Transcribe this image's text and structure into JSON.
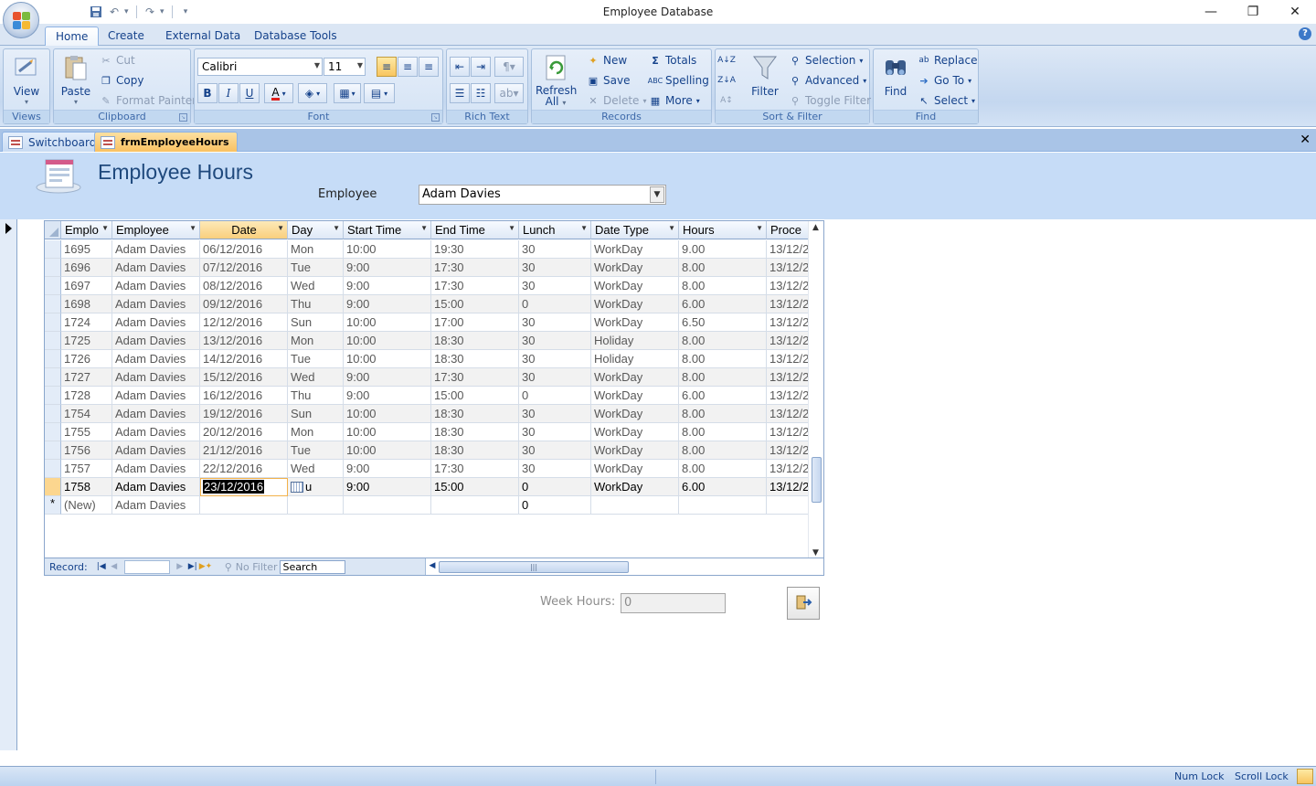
{
  "window": {
    "title": "Employee Database",
    "minimize_glyph": "—",
    "restore_glyph": "❐",
    "close_glyph": "✕"
  },
  "ribbon_tabs": [
    "Home",
    "Create",
    "External Data",
    "Database Tools"
  ],
  "ribbon": {
    "views": {
      "view_label": "View",
      "group_label": "Views"
    },
    "clipboard": {
      "paste_label": "Paste",
      "cut_label": "Cut",
      "copy_label": "Copy",
      "format_painter_label": "Format Painter",
      "group_label": "Clipboard"
    },
    "font": {
      "font_name": "Calibri",
      "font_size": "11",
      "bold": "B",
      "italic": "I",
      "underline": "U",
      "group_label": "Font"
    },
    "rich_text": {
      "group_label": "Rich Text"
    },
    "records": {
      "refresh_label": "Refresh",
      "refresh_label2": "All",
      "new_label": "New",
      "save_label": "Save",
      "delete_label": "Delete",
      "totals_label": "Totals",
      "spelling_label": "Spelling",
      "more_label": "More",
      "group_label": "Records"
    },
    "sort_filter": {
      "filter_label": "Filter",
      "selection_label": "Selection",
      "advanced_label": "Advanced",
      "toggle_filter_label": "Toggle Filter",
      "group_label": "Sort & Filter"
    },
    "find": {
      "find_label": "Find",
      "replace_label": "Replace",
      "goto_label": "Go To",
      "select_label": "Select",
      "group_label": "Find"
    }
  },
  "doc_tabs": [
    {
      "label": "Switchboard",
      "active": false
    },
    {
      "label": "frmEmployeeHours",
      "active": true
    }
  ],
  "form": {
    "title": "Employee Hours",
    "employee_label": "Employee",
    "employee_value": "Adam Davies"
  },
  "datasheet": {
    "columns": [
      "Emplo",
      "Employee",
      "Date",
      "Day",
      "Start Time",
      "End Time",
      "Lunch",
      "Date Type",
      "Hours",
      "Proce"
    ],
    "rows": [
      [
        "1695",
        "Adam Davies",
        "06/12/2016",
        "Mon",
        "10:00",
        "19:30",
        "30",
        "WorkDay",
        "9.00",
        "13/12/2"
      ],
      [
        "1696",
        "Adam Davies",
        "07/12/2016",
        "Tue",
        "9:00",
        "17:30",
        "30",
        "WorkDay",
        "8.00",
        "13/12/2"
      ],
      [
        "1697",
        "Adam Davies",
        "08/12/2016",
        "Wed",
        "9:00",
        "17:30",
        "30",
        "WorkDay",
        "8.00",
        "13/12/2"
      ],
      [
        "1698",
        "Adam Davies",
        "09/12/2016",
        "Thu",
        "9:00",
        "15:00",
        "0",
        "WorkDay",
        "6.00",
        "13/12/2"
      ],
      [
        "1724",
        "Adam Davies",
        "12/12/2016",
        "Sun",
        "10:00",
        "17:00",
        "30",
        "WorkDay",
        "6.50",
        "13/12/2"
      ],
      [
        "1725",
        "Adam Davies",
        "13/12/2016",
        "Mon",
        "10:00",
        "18:30",
        "30",
        "Holiday",
        "8.00",
        "13/12/2"
      ],
      [
        "1726",
        "Adam Davies",
        "14/12/2016",
        "Tue",
        "10:00",
        "18:30",
        "30",
        "Holiday",
        "8.00",
        "13/12/2"
      ],
      [
        "1727",
        "Adam Davies",
        "15/12/2016",
        "Wed",
        "9:00",
        "17:30",
        "30",
        "WorkDay",
        "8.00",
        "13/12/2"
      ],
      [
        "1728",
        "Adam Davies",
        "16/12/2016",
        "Thu",
        "9:00",
        "15:00",
        "0",
        "WorkDay",
        "6.00",
        "13/12/2"
      ],
      [
        "1754",
        "Adam Davies",
        "19/12/2016",
        "Sun",
        "10:00",
        "18:30",
        "30",
        "WorkDay",
        "8.00",
        "13/12/2"
      ],
      [
        "1755",
        "Adam Davies",
        "20/12/2016",
        "Mon",
        "10:00",
        "18:30",
        "30",
        "WorkDay",
        "8.00",
        "13/12/2"
      ],
      [
        "1756",
        "Adam Davies",
        "21/12/2016",
        "Tue",
        "10:00",
        "18:30",
        "30",
        "WorkDay",
        "8.00",
        "13/12/2"
      ],
      [
        "1757",
        "Adam Davies",
        "22/12/2016",
        "Wed",
        "9:00",
        "17:30",
        "30",
        "WorkDay",
        "8.00",
        "13/12/2"
      ],
      [
        "1758",
        "Adam Davies",
        "23/12/2016",
        "u",
        "9:00",
        "15:00",
        "0",
        "WorkDay",
        "6.00",
        "13/12/2"
      ]
    ],
    "current_row_index": 13,
    "new_row": {
      "marker": "*",
      "id": "(New)",
      "employee": "Adam Davies",
      "lunch": "0"
    }
  },
  "navigation": {
    "record_label": "Record:",
    "record_value": "",
    "no_filter_label": "No Filter",
    "search_placeholder": "Search"
  },
  "week_hours": {
    "label": "Week Hours:",
    "value": "0"
  },
  "status_bar": {
    "num_lock": "Num Lock",
    "scroll_lock": "Scroll Lock"
  }
}
